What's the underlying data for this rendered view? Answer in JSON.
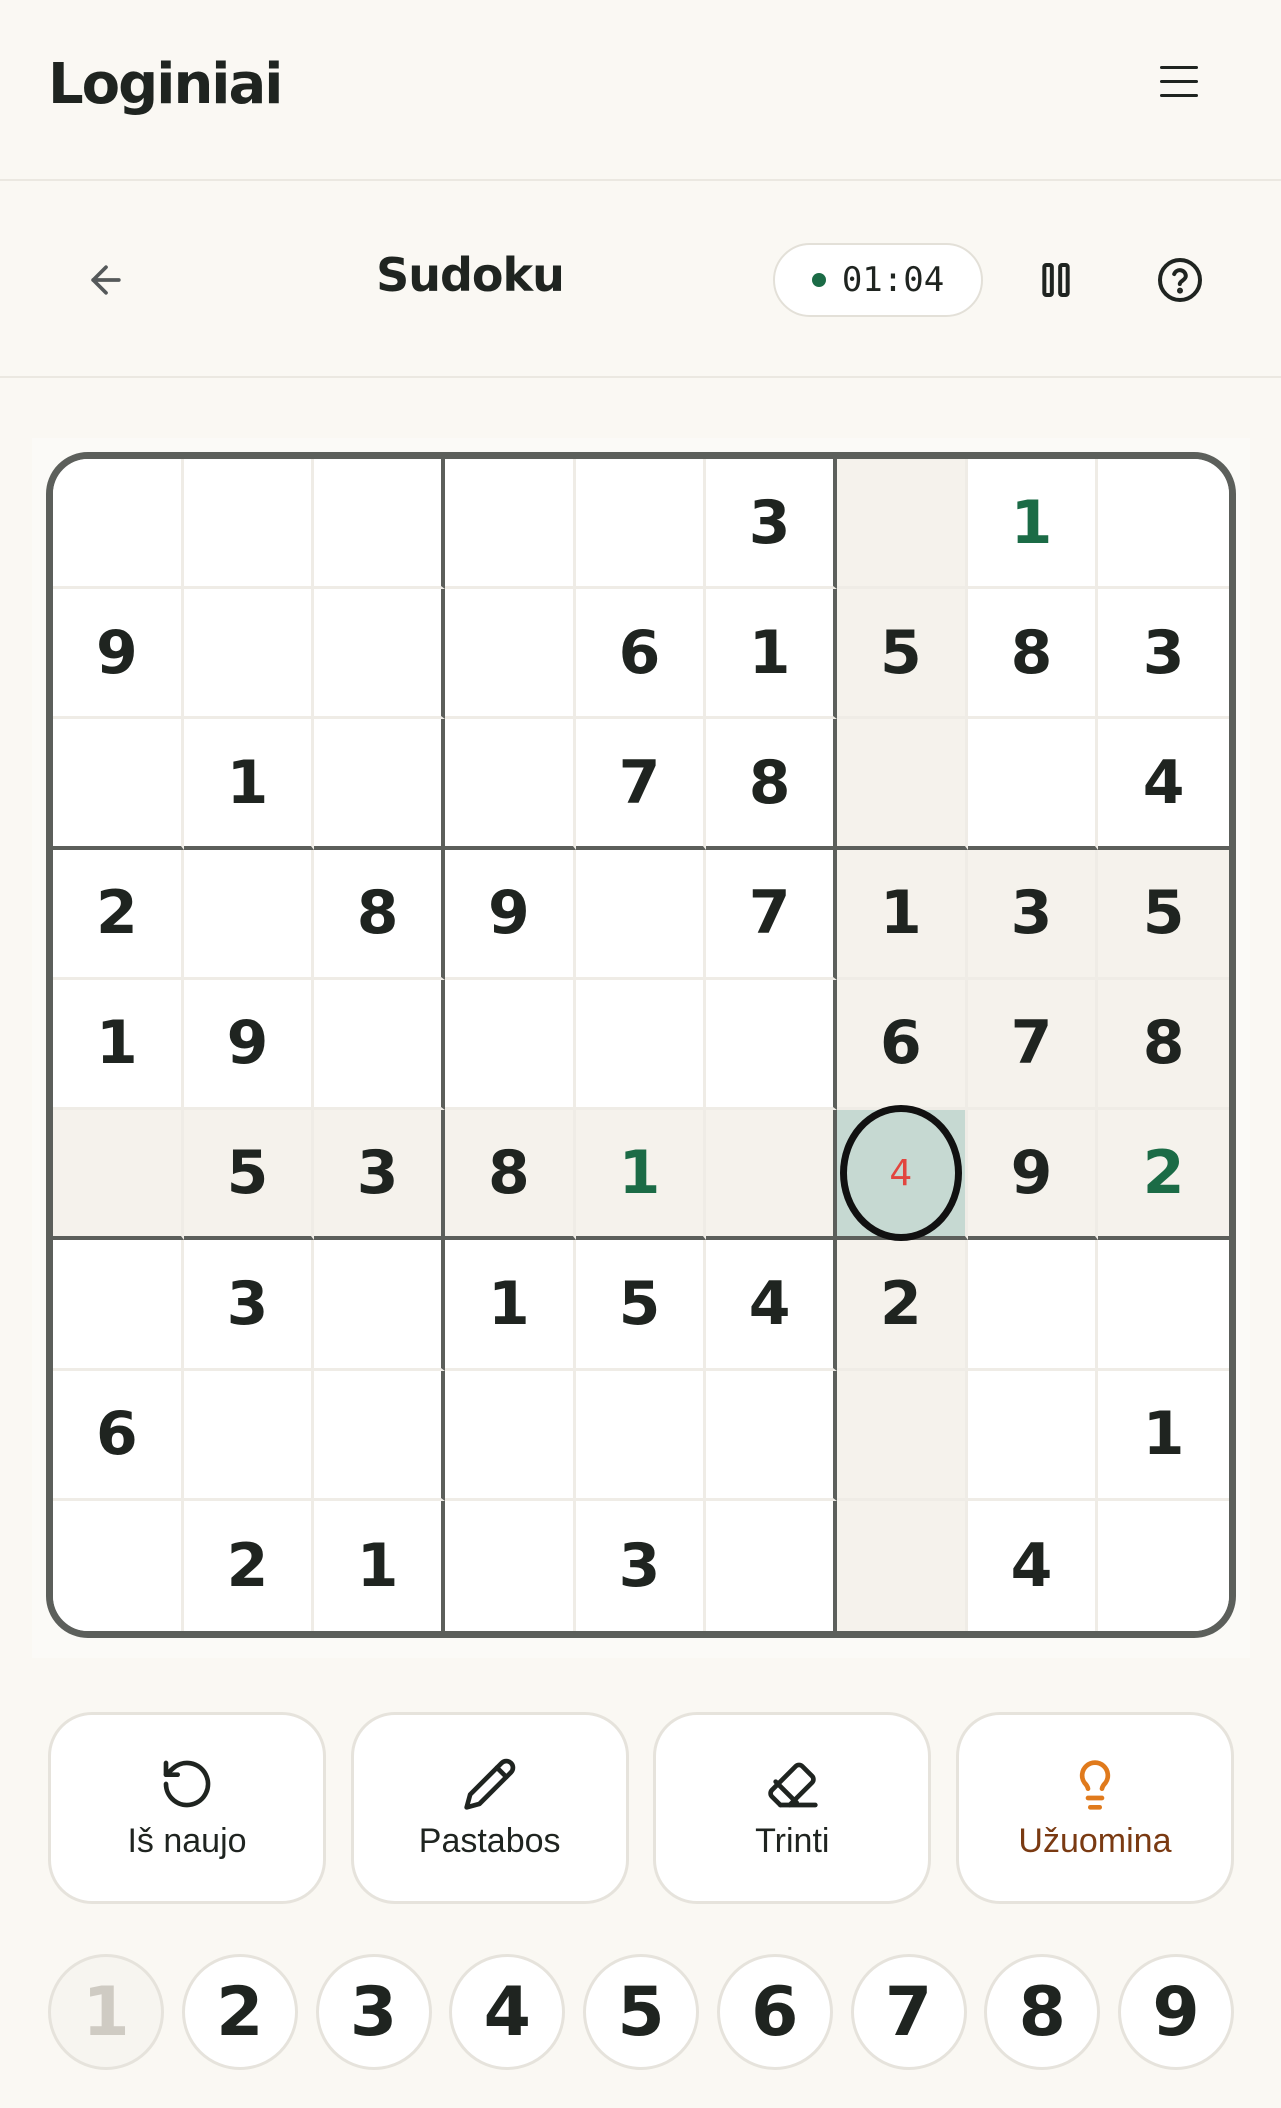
{
  "header": {
    "logo": "Loginiai",
    "menu_icon": "hamburger-icon"
  },
  "game_bar": {
    "title": "Sudoku",
    "timer": "01:04",
    "back_icon": "arrow-left-icon",
    "pause_icon": "pause-icon",
    "help_icon": "help-circle-icon"
  },
  "board": {
    "rows": [
      [
        "",
        "",
        "",
        "",
        "",
        "3",
        "",
        "1",
        ""
      ],
      [
        "9",
        "",
        "",
        "",
        "6",
        "1",
        "5",
        "8",
        "3"
      ],
      [
        "",
        "1",
        "",
        "",
        "7",
        "8",
        "",
        "",
        "4"
      ],
      [
        "2",
        "",
        "8",
        "9",
        "",
        "7",
        "1",
        "3",
        "5"
      ],
      [
        "1",
        "9",
        "",
        "",
        "",
        "",
        "6",
        "7",
        "8"
      ],
      [
        "",
        "5",
        "3",
        "8",
        "1",
        "",
        "4",
        "9",
        "2"
      ],
      [
        "",
        "3",
        "",
        "1",
        "5",
        "4",
        "2",
        "",
        ""
      ],
      [
        "6",
        "",
        "",
        "",
        "",
        "",
        "",
        "",
        "1"
      ],
      [
        "",
        "2",
        "1",
        "",
        "3",
        "",
        "",
        "4",
        ""
      ]
    ],
    "user_entries": [
      [
        0,
        7
      ],
      [
        5,
        4
      ],
      [
        5,
        8
      ]
    ],
    "selected": [
      5,
      6
    ],
    "selected_color": "#c6d9d2",
    "highlight_color": "#f5f2ec",
    "user_color": "#1b6b46",
    "error_color": "#e2463f"
  },
  "actions": [
    {
      "label": "Iš naujo",
      "icon": "restart-icon"
    },
    {
      "label": "Pastabos",
      "icon": "pencil-icon"
    },
    {
      "label": "Trinti",
      "icon": "eraser-icon"
    },
    {
      "label": "Užuomina",
      "icon": "lightbulb-icon"
    }
  ],
  "numpad": [
    {
      "label": "1",
      "state": "done"
    },
    {
      "label": "2",
      "state": "active"
    },
    {
      "label": "3",
      "state": "active"
    },
    {
      "label": "4",
      "state": "active"
    },
    {
      "label": "5",
      "state": "active"
    },
    {
      "label": "6",
      "state": "active"
    },
    {
      "label": "7",
      "state": "active"
    },
    {
      "label": "8",
      "state": "active"
    },
    {
      "label": "9",
      "state": "active"
    }
  ]
}
